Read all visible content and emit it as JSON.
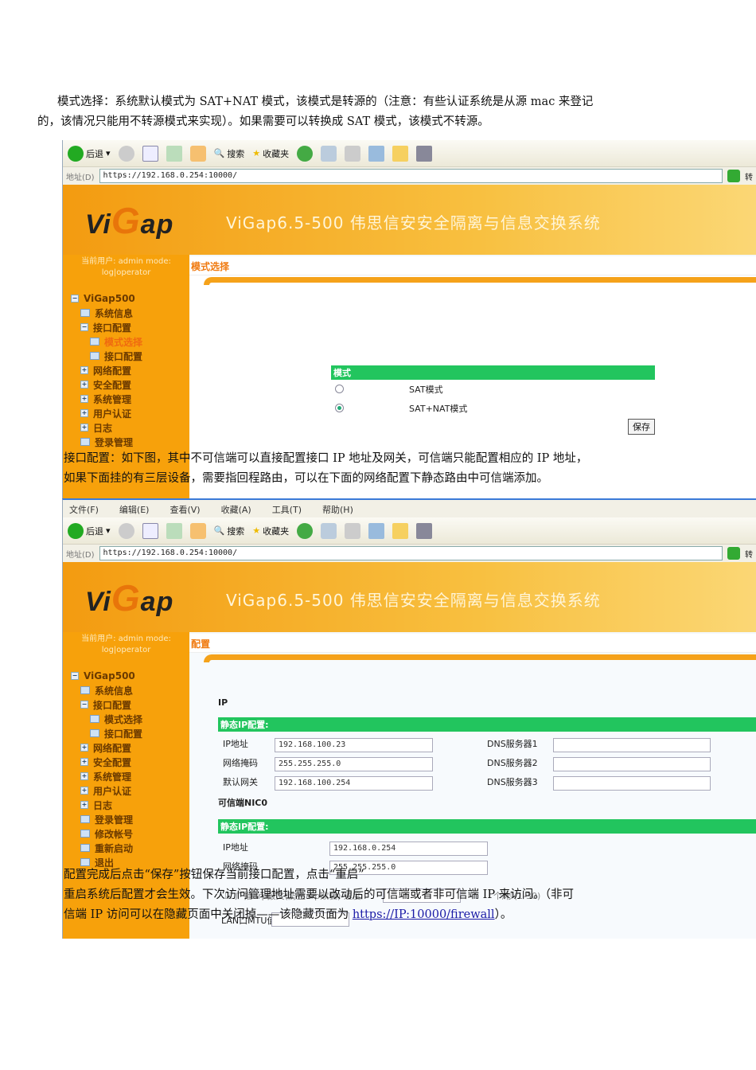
{
  "paragraphs": {
    "p1_line1": "模式选择：系统默认模式为 SAT+NAT 模式，该模式是转源的（注意：有些认证系统是从源 mac 来登记",
    "p1_line2": "的，该情况只能用不转源模式来实现）。如果需要可以转换成 SAT 模式，该模式不转源。",
    "p2_line1": "接口配置：如下图，其中不可信端可以直接配置接口 IP 地址及网关，可信端只能配置相应的 IP 地址，",
    "p2_line2": "如果下面挂的有三层设备，需要指回程路由，可以在下面的网络配置下静态路由中可信端添加。",
    "p3_line1": "配置完成后点击“保存”按钮保存当前接口配置，点击“重启”",
    "p3_line2": "重启系统后配置才会生效。下次访问管理地址需要以改动后的可信端或者非可信端 IP 来访问。（非可",
    "p3_line3_pre": "信端 IP 访问可以在隐藏页面中关闭掉——该隐藏页面为 ",
    "p3_link": "https://IP:10000/firewall",
    "p3_line3_post": "）。"
  },
  "browser": {
    "menu": [
      "文件(F)",
      "编辑(E)",
      "查看(V)",
      "收藏(A)",
      "工具(T)",
      "帮助(H)"
    ],
    "back": "后退",
    "search": "搜索",
    "favorites": "收藏夹",
    "address_label": "地址(D)",
    "url": "https://192.168.0.254:10000/",
    "go": "转"
  },
  "app": {
    "logo": "ViGap",
    "title": "ViGap6.5-500  伟思信安安全隔离与信息交换系统",
    "user_line1": "当前用户: admin mode:",
    "user_line2": "log|operator",
    "tree": {
      "root": "ViGap500",
      "sysinfo": "系统信息",
      "iface": "接口配置",
      "mode": "模式选择",
      "ifconf": "接口配置",
      "net": "网络配置",
      "sec": "安全配置",
      "sysmgmt": "系统管理",
      "auth": "用户认证",
      "log": "日志",
      "login": "登录管理",
      "passwd": "修改帐号",
      "reboot": "重新启动",
      "exit": "退出"
    }
  },
  "shot1": {
    "page_title": "模式选择",
    "section": "模式",
    "opt_sat": "SAT模式",
    "opt_satnat": "SAT+NAT模式",
    "selected": "SAT+NAT模式",
    "save": "保存"
  },
  "shot2": {
    "page_title": "配置",
    "ip_heading": "IP",
    "static_ip": "静态IP配置:",
    "ip_label": "IP地址",
    "mask_label": "网络掩码",
    "gw_label": "默认网关",
    "ip": "192.168.100.23",
    "mask": "255.255.255.0",
    "gw": "192.168.100.254",
    "dns1": "DNS服务器1",
    "dns2": "DNS服务器2",
    "dns3": "DNS服务器3",
    "trusted": "可信端NIC0",
    "static_ip2": "静态IP配置:",
    "ip2_label": "IP地址",
    "ip2": "192.168.0.254",
    "mask2_label": "网络掩码",
    "mask2": "255.255.255.0",
    "arp": "广播arp报文(防止arp欺骗) 速度",
    "arp_unit": "个/秒(1-30)",
    "mtu": "LAN口MTU值"
  }
}
